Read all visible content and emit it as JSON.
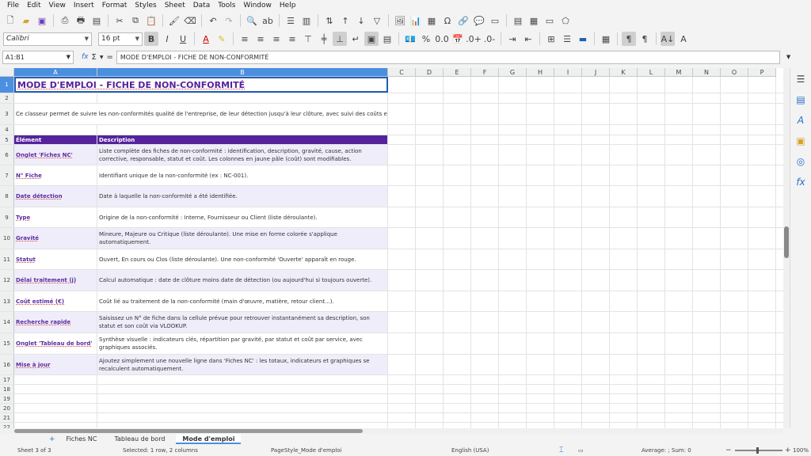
{
  "menu": [
    "File",
    "Edit",
    "View",
    "Insert",
    "Format",
    "Styles",
    "Sheet",
    "Data",
    "Tools",
    "Window",
    "Help"
  ],
  "font": {
    "name": "Calibri",
    "size": "16 pt"
  },
  "formula_bar": {
    "name_box": "A1:B1",
    "function_wizard": "fx",
    "sum": "Σ",
    "equals": "=",
    "content": "MODE D'EMPLOI - FICHE DE NON-CONFORMITÉ"
  },
  "columns": [
    "A",
    "B",
    "C",
    "D",
    "E",
    "F",
    "G",
    "H",
    "I",
    "J",
    "K",
    "L",
    "M",
    "N",
    "O",
    "P"
  ],
  "title": "MODE D'EMPLOI - FICHE DE NON-CONFORMITÉ",
  "intro": "Ce classeur permet de suivre les non-conformités qualité de l'entreprise, de leur détection jusqu'à leur clôture, avec suivi des coûts et des délais.",
  "table_header": {
    "col_a": "Élément",
    "col_b": "Description"
  },
  "rows": [
    {
      "num": "6",
      "label": "Onglet 'Fiches NC'",
      "desc": "Liste complète des fiches de non-conformité : identification, description, gravité, cause, action corrective, responsable, statut et coût. Les colonnes en jaune pâle (coût) sont modifiables."
    },
    {
      "num": "7",
      "label": "N° Fiche",
      "desc": "Identifiant unique de la non-conformité (ex : NC-001)."
    },
    {
      "num": "8",
      "label": "Date détection",
      "desc": "Date à laquelle la non-conformité a été identifiée."
    },
    {
      "num": "9",
      "label": "Type",
      "desc": "Origine de la non-conformité : Interne, Fournisseur ou Client (liste déroulante)."
    },
    {
      "num": "10",
      "label": "Gravité",
      "desc": "Mineure, Majeure ou Critique (liste déroulante). Une mise en forme colorée s'applique automatiquement."
    },
    {
      "num": "11",
      "label": "Statut",
      "desc": "Ouvert, En cours ou Clos (liste déroulante). Une non-conformité 'Ouverte' apparaît en rouge."
    },
    {
      "num": "12",
      "label": "Délai traitement (j)",
      "desc": "Calcul automatique : date de clôture moins date de détection (ou aujourd'hui si toujours ouverte)."
    },
    {
      "num": "13",
      "label": "Coût estimé (€)",
      "desc": "Coût lié au traitement de la non-conformité (main d'œuvre, matière, retour client...)."
    },
    {
      "num": "14",
      "label": "Recherche rapide",
      "desc": "Saisissez un N° de fiche dans la cellule prévue pour retrouver instantanément sa description, son statut et son coût via VLOOKUP."
    },
    {
      "num": "15",
      "label": "Onglet 'Tableau de bord'",
      "desc": "Synthèse visuelle : indicateurs clés, répartition par gravité, par statut et coût par service, avec graphiques associés."
    },
    {
      "num": "16",
      "label": "Mise à jour",
      "desc": "Ajoutez simplement une nouvelle ligne dans 'Fiches NC' : les totaux, indicateurs et graphiques se recalculent automatiquement."
    }
  ],
  "empty_rows": [
    "17",
    "18",
    "19",
    "20",
    "21",
    "22"
  ],
  "sheet_tabs": {
    "add": "+",
    "tabs": [
      "Fiches NC",
      "Tableau de bord",
      "Mode d'emploi"
    ],
    "active": "Mode d'emploi"
  },
  "status": {
    "sheet": "Sheet 3 of 3",
    "selection": "Selected: 1 row, 2 columns",
    "page_style": "PageStyle_Mode d'emploi",
    "language": "English (USA)",
    "summary": "Average: ; Sum: 0",
    "zoom": "100%"
  }
}
